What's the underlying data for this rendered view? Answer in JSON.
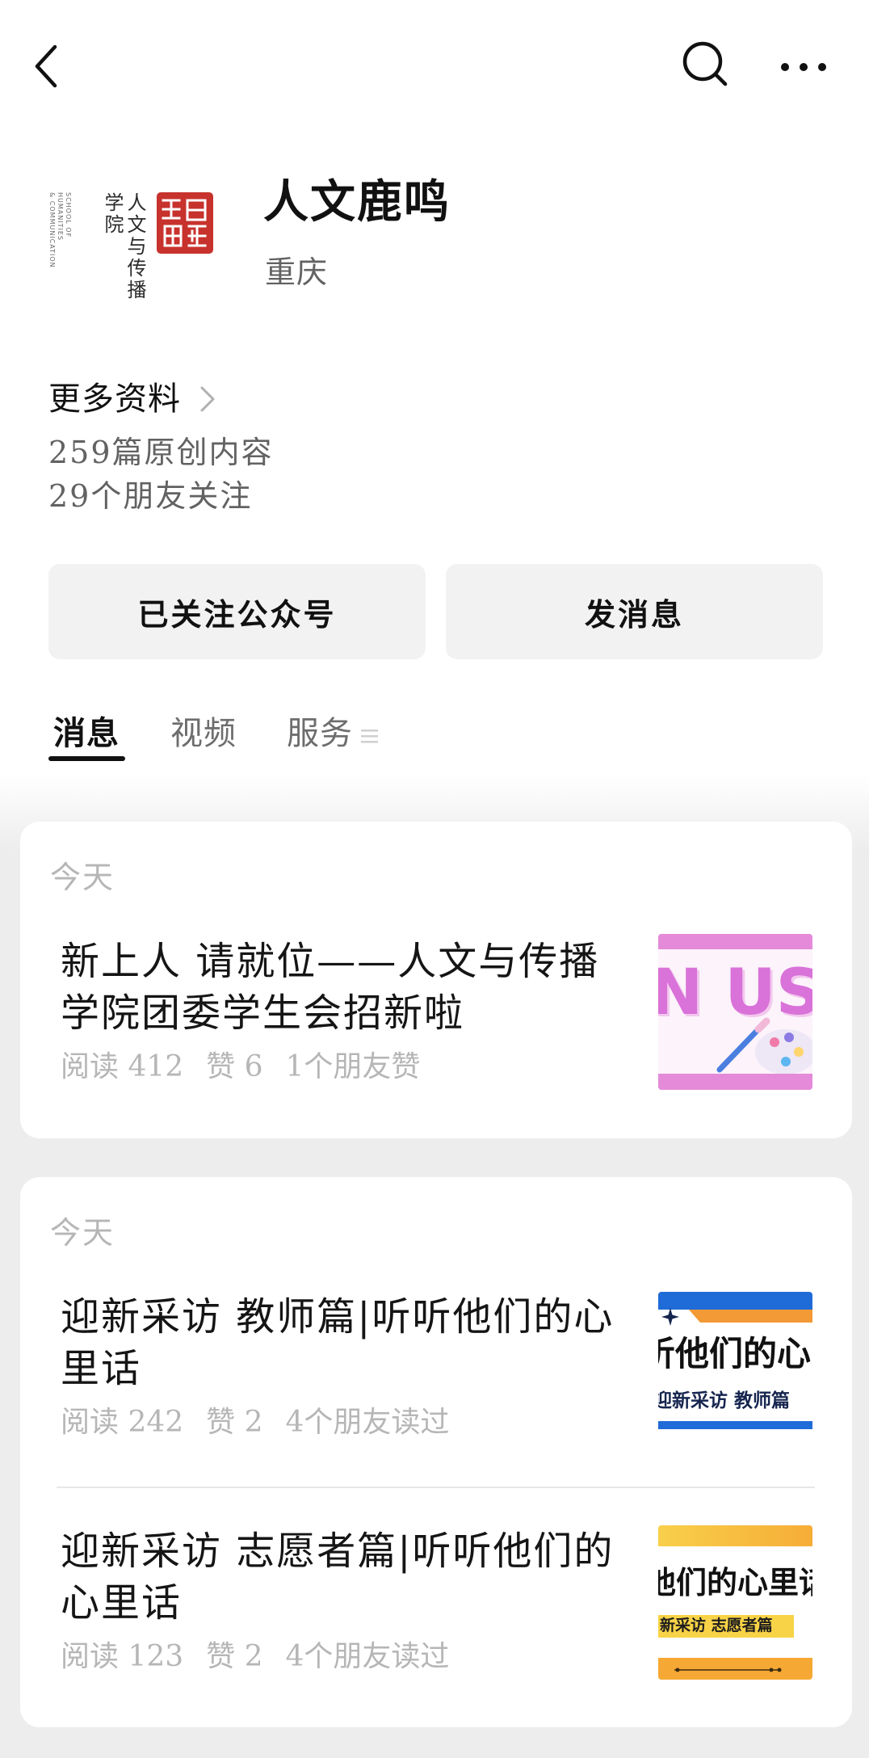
{
  "header": {
    "back_icon": "chevron-left-icon",
    "search_icon": "search-icon",
    "more_icon": "more-horizontal-icon"
  },
  "profile": {
    "name": "人文鹿鸣",
    "location": "重庆",
    "logo": {
      "seal_icon": "red-seal-logo",
      "name_cn": "人文与传播",
      "college_cn": "学院",
      "name_en": [
        "SCHOOL OF",
        "HUMANITIES",
        "& COMMUNICATION"
      ]
    },
    "more_info": {
      "label": "更多资料",
      "icon": "chevron-right-icon"
    },
    "original_articles": "259篇原创内容",
    "friends_following": "29个朋友关注"
  },
  "actions": {
    "followed_label": "已关注公众号",
    "message_label": "发消息"
  },
  "tabs": {
    "items": [
      {
        "label": "消息",
        "active": true
      },
      {
        "label": "视频",
        "active": false
      },
      {
        "label": "服务",
        "active": false
      }
    ],
    "menu_icon": "menu-lines-icon"
  },
  "feed": [
    {
      "date": "今天",
      "articles": [
        {
          "title": "新上人 请就位——人文与传播学院团委学生会招新啦",
          "reads": "阅读 412",
          "likes": "赞 6",
          "social": "1个朋友赞",
          "thumbnail": {
            "text": "N US",
            "icon": "palette-brush-icon"
          }
        }
      ]
    },
    {
      "date": "今天",
      "articles": [
        {
          "title": "迎新采访 教师篇|听听他们的心里话",
          "reads": "阅读 242",
          "likes": "赞 2",
          "social": "4个朋友读过",
          "thumbnail": {
            "headline": "听他们的心",
            "caption": "迎新采访 教师篇",
            "icon": "sparkle-star-icon"
          }
        },
        {
          "title": "迎新采访 志愿者篇|听听他们的心里话",
          "reads": "阅读 123",
          "likes": "赞 2",
          "social": "4个朋友读过",
          "thumbnail": {
            "headline": "他们的心里话",
            "caption": "新采访 志愿者篇"
          }
        }
      ]
    }
  ],
  "colors": {
    "text_primary": "#111111",
    "text_secondary": "#626262",
    "text_muted": "#b6b6b6",
    "button_bg": "#f2f2f2",
    "feed_bg": "#ededed",
    "seal_red": "#c7322d"
  }
}
